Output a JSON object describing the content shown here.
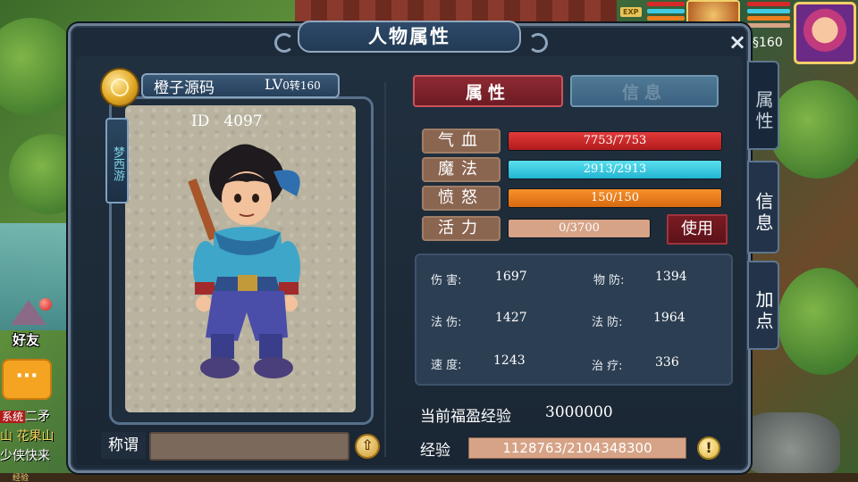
{
  "window": {
    "title": "人物属性",
    "close_symbol": "×"
  },
  "hud": {
    "exp_badge": "EXP",
    "currency_prefix": "§",
    "currency_value": "160"
  },
  "left_hud": {
    "friends_label": "好友",
    "chat_icon_symbol": "···",
    "chat_lines": [
      {
        "tag": "系统",
        "text": "二矛"
      },
      {
        "text": "山 花果山"
      },
      {
        "text": "少侠快来"
      }
    ]
  },
  "bottom_bar": {
    "label": "经验"
  },
  "character": {
    "name": "橙子源码",
    "level_prefix": "LV",
    "level_text": "0转160",
    "id_label": "ID",
    "id_value": "4097",
    "sect": "梦西游",
    "title_label": "称谓",
    "title_value": ""
  },
  "tabs": {
    "attributes": "属性",
    "info": "信息"
  },
  "side_tabs": [
    {
      "label": "属性",
      "active": true
    },
    {
      "label": "信息",
      "active": false
    },
    {
      "label": "加点",
      "active": false
    }
  ],
  "stats": {
    "hp": {
      "label": "气血",
      "value": "7753/7753",
      "current": 7753,
      "max": 7753
    },
    "mp": {
      "label": "魔法",
      "value": "2913/2913",
      "current": 2913,
      "max": 2913
    },
    "anger": {
      "label": "愤怒",
      "value": "150/150",
      "current": 150,
      "max": 150
    },
    "vitality": {
      "label": "活力",
      "value": "0/3700",
      "current": 0,
      "max": 3700
    },
    "use_button": "使用"
  },
  "attributes": {
    "damage": {
      "label": "伤 害:",
      "value": "1697"
    },
    "phys_def": {
      "label": "物 防:",
      "value": "1394"
    },
    "magic_dmg": {
      "label": "法 伤:",
      "value": "1427"
    },
    "magic_def": {
      "label": "法 防:",
      "value": "1964"
    },
    "speed": {
      "label": "速 度:",
      "value": "1243"
    },
    "heal": {
      "label": "治 疗:",
      "value": "336"
    }
  },
  "bonus_exp": {
    "label": "当前福盈经验",
    "value": "3000000"
  },
  "experience": {
    "label": "经验",
    "value": "1128763/2104348300",
    "current": 1128763,
    "max": 2104348300
  },
  "colors": {
    "hp": "#d62a2a",
    "mp": "#3fcbe2",
    "anger": "#ee7e1c",
    "vitality": "#d6a387",
    "active_tab": "#7e222b",
    "panel": "#1c2a3a"
  }
}
